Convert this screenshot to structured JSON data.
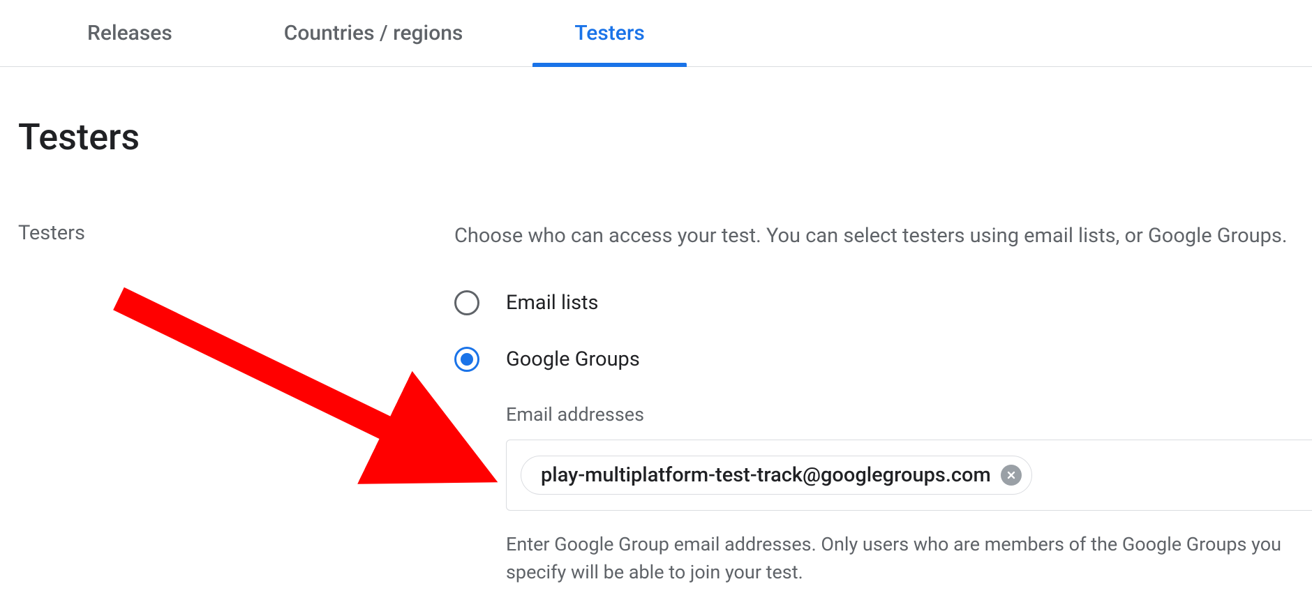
{
  "tabs": [
    {
      "label": "Releases",
      "active": false
    },
    {
      "label": "Countries / regions",
      "active": false
    },
    {
      "label": "Testers",
      "active": true
    }
  ],
  "section": {
    "heading": "Testers"
  },
  "settings": {
    "label": "Testers",
    "description": "Choose who can access your test. You can select testers using email lists, or Google Groups.",
    "options": [
      {
        "label": "Email lists",
        "selected": false
      },
      {
        "label": "Google Groups",
        "selected": true
      }
    ],
    "email_field": {
      "label": "Email addresses",
      "chips": [
        {
          "value": "play-multiplatform-test-track@googlegroups.com"
        }
      ],
      "helper": "Enter Google Group email addresses. Only users who are members of the Google Groups you specify will be able to join your test."
    }
  },
  "annotation": {
    "color": "#ff0000"
  }
}
